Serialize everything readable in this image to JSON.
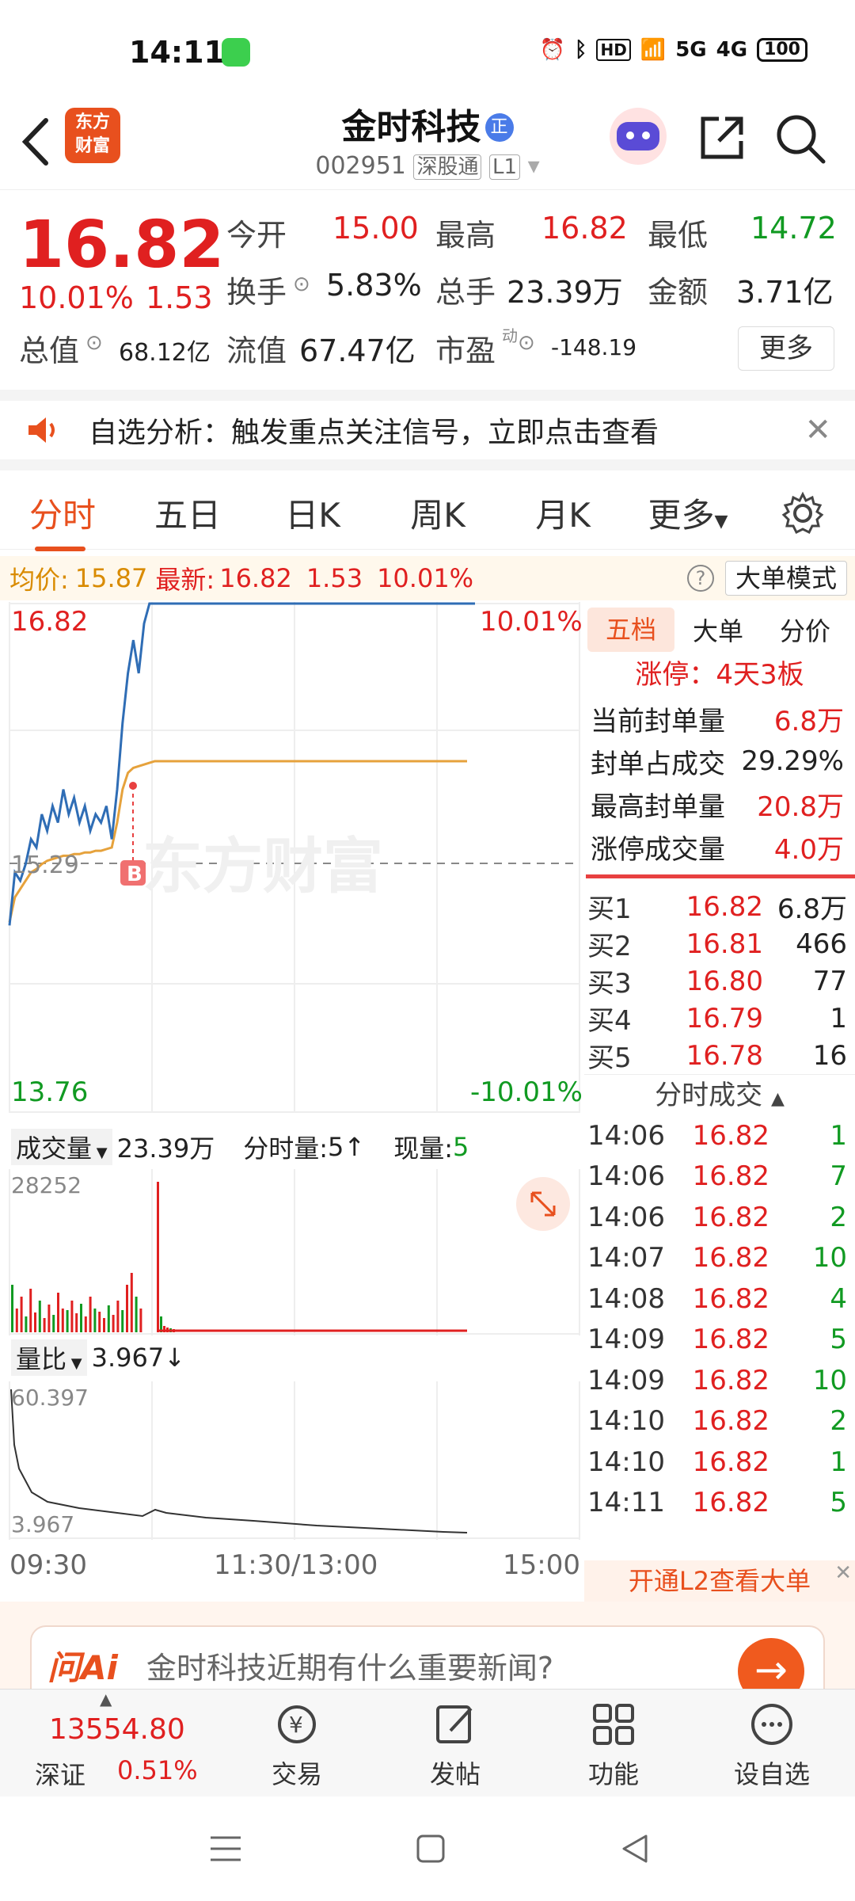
{
  "status": {
    "time": "14:11",
    "hd": "HD",
    "net1": "5G",
    "net2": "4G",
    "battery": "100"
  },
  "header": {
    "logo_line1": "东方",
    "logo_line2": "财富",
    "stock_name": "金时科技",
    "badge": "正",
    "code": "002951",
    "market": "深股通",
    "level": "L1"
  },
  "quote": {
    "price": "16.82",
    "change_pct": "10.01%",
    "change": "1.53",
    "open_label": "今开",
    "open": "15.00",
    "high_label": "最高",
    "high": "16.82",
    "low_label": "最低",
    "low": "14.72",
    "turnover_label": "换手",
    "turnover": "5.83%",
    "volume_label": "总手",
    "volume": "23.39万",
    "amount_label": "金额",
    "amount": "3.71亿",
    "mktcap_label": "总值",
    "mktcap": "68.12亿",
    "float_label": "流值",
    "float_cap": "67.47亿",
    "pe_label": "市盈",
    "pe_sup": "动",
    "pe": "-148.19",
    "more": "更多"
  },
  "notice": {
    "text": "自选分析：触发重点关注信号，立即点击查看"
  },
  "tabs": [
    "分时",
    "五日",
    "日K",
    "周K",
    "月K",
    "更多"
  ],
  "info": {
    "avg_label": "均价:",
    "avg": "15.87",
    "latest_label": "最新:",
    "latest": "16.82",
    "change": "1.53",
    "pct": "10.01%",
    "mode": "大单模式"
  },
  "chart": {
    "top_price": "16.82",
    "top_pct": "10.01%",
    "mid_price": "15.29",
    "bottom_price": "13.76",
    "bottom_pct": "-10.01%",
    "marker": "B",
    "watermark": "东方财富",
    "vol_label": "成交量",
    "vol_total": "23.39万",
    "min_vol_label": "分时量:",
    "min_vol": "5",
    "cur_vol_label": "现量:",
    "cur_vol": "5",
    "vol_max": "28252",
    "ratio_label": "量比",
    "ratio": "3.967",
    "ratio_max": "60.397",
    "ratio_min": "3.967",
    "time_start": "09:30",
    "time_mid": "11:30/13:00",
    "time_end": "15:00"
  },
  "chart_data": {
    "type": "line",
    "x_range": [
      "09:30",
      "15:00"
    ],
    "ylim": [
      13.76,
      16.82
    ],
    "prev_close": 15.29,
    "series": [
      {
        "values": [
          14.88,
          15.2,
          15.15,
          15.25,
          15.4,
          15.35,
          15.55,
          15.45,
          15.6,
          15.5,
          15.7,
          15.55,
          15.65,
          15.5,
          15.6,
          15.45,
          15.55,
          15.5,
          15.6,
          15.4,
          15.7,
          16.1,
          16.4,
          16.6,
          16.4,
          16.7,
          16.82,
          16.82,
          16.82,
          16.82
        ]
      },
      {
        "values": [
          14.9,
          15.05,
          15.1,
          15.15,
          15.2,
          15.22,
          15.25,
          15.27,
          15.28,
          15.29,
          15.3,
          15.3,
          15.31,
          15.31,
          15.32,
          15.32,
          15.33,
          15.33,
          15.34,
          15.35,
          15.5,
          15.7,
          15.8,
          15.83,
          15.84,
          15.85,
          15.86,
          15.87,
          15.87,
          15.87
        ]
      }
    ]
  },
  "panel": {
    "tabs": [
      "五档",
      "大单",
      "分价"
    ],
    "limit": "涨停：4天3板",
    "stats": [
      {
        "label": "当前封单量",
        "value": "6.8万"
      },
      {
        "label": "封单占成交",
        "value": "29.29%"
      },
      {
        "label": "最高封单量",
        "value": "20.8万"
      },
      {
        "label": "涨停成交量",
        "value": "4.0万"
      }
    ],
    "book": [
      {
        "label": "买1",
        "price": "16.82",
        "vol": "6.8万"
      },
      {
        "label": "买2",
        "price": "16.81",
        "vol": "466"
      },
      {
        "label": "买3",
        "price": "16.80",
        "vol": "77"
      },
      {
        "label": "买4",
        "price": "16.79",
        "vol": "1"
      },
      {
        "label": "买5",
        "price": "16.78",
        "vol": "16"
      }
    ],
    "ticks_title": "分时成交",
    "ticks": [
      {
        "time": "14:06",
        "price": "16.82",
        "vol": "1"
      },
      {
        "time": "14:06",
        "price": "16.82",
        "vol": "7"
      },
      {
        "time": "14:06",
        "price": "16.82",
        "vol": "2"
      },
      {
        "time": "14:07",
        "price": "16.82",
        "vol": "10"
      },
      {
        "time": "14:08",
        "price": "16.82",
        "vol": "4"
      },
      {
        "time": "14:09",
        "price": "16.82",
        "vol": "5"
      },
      {
        "time": "14:09",
        "price": "16.82",
        "vol": "10"
      },
      {
        "time": "14:10",
        "price": "16.82",
        "vol": "2"
      },
      {
        "time": "14:10",
        "price": "16.82",
        "vol": "1"
      },
      {
        "time": "14:11",
        "price": "16.82",
        "vol": "5"
      }
    ],
    "l2": "开通L2查看大单"
  },
  "ask": {
    "brand": "问Ai",
    "placeholder": "金时科技近期有什么重要新闻?"
  },
  "bottom": {
    "index_value": "13554.80",
    "index_name": "深证",
    "index_pct": "0.51%",
    "trade": "交易",
    "post": "发帖",
    "func": "功能",
    "watch": "设自选"
  }
}
